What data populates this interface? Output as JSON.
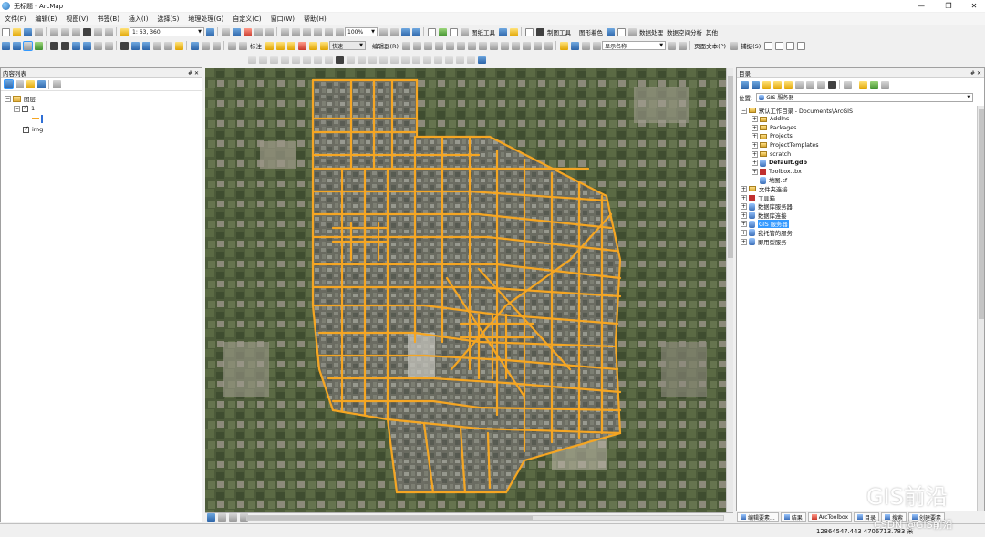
{
  "window": {
    "title": "无标题 - ArcMap",
    "controls": [
      "—",
      "❐",
      "✕"
    ]
  },
  "menu": [
    "文件(F)",
    "编辑(E)",
    "视图(V)",
    "书签(B)",
    "插入(I)",
    "选择(S)",
    "地理处理(G)",
    "自定义(C)",
    "窗口(W)",
    "帮助(H)"
  ],
  "toolbar1": {
    "scale": "1: 63, 360",
    "zoom": "100%",
    "georef_label": "图纸工具",
    "draw_label": "制图工具",
    "graphic_label": "图形着色",
    "data_proc_label": "数据处理",
    "spatial_label": "数据空间分析",
    "other_label": "其他"
  },
  "toolbar2": {
    "label_tool": "标注",
    "font_combo": "快速",
    "editor_label": "编辑器(R)",
    "display_combo": "显示名称",
    "layout_label": "页面文本(P)",
    "snapping_label": "捕捉(S)"
  },
  "toc": {
    "title": "内容列表",
    "header_controls": "# ✕",
    "layers_root": "图层",
    "layer1": "1",
    "layer2": "img"
  },
  "catalog": {
    "title": "目录",
    "header_controls": "# ✕",
    "location_label": "位置:",
    "location_value": "GIS 服务器",
    "tree": [
      {
        "label": "默认工作目录 - Documents\\ArcGIS",
        "level": 0,
        "expander": "−",
        "icon": "home"
      },
      {
        "label": "AddIns",
        "level": 1,
        "expander": "+",
        "icon": "folder"
      },
      {
        "label": "Packages",
        "level": 1,
        "expander": "+",
        "icon": "folder"
      },
      {
        "label": "Projects",
        "level": 1,
        "expander": "+",
        "icon": "folder"
      },
      {
        "label": "ProjectTemplates",
        "level": 1,
        "expander": "+",
        "icon": "folder"
      },
      {
        "label": "scratch",
        "level": 1,
        "expander": "+",
        "icon": "folder"
      },
      {
        "label": "Default.gdb",
        "level": 1,
        "expander": "+",
        "icon": "gdb",
        "bold": true
      },
      {
        "label": "Toolbox.tbx",
        "level": 1,
        "expander": "+",
        "icon": "box"
      },
      {
        "label": "地图.sf",
        "level": 1,
        "expander": "",
        "icon": "db"
      },
      {
        "label": "文件夹连接",
        "level": 0,
        "expander": "+",
        "icon": "folder"
      },
      {
        "label": "工具箱",
        "level": 0,
        "expander": "+",
        "icon": "box"
      },
      {
        "label": "数据库服务器",
        "level": 0,
        "expander": "+",
        "icon": "db"
      },
      {
        "label": "数据库连接",
        "level": 0,
        "expander": "+",
        "icon": "db"
      },
      {
        "label": "GIS 服务器",
        "level": 0,
        "expander": "+",
        "icon": "db",
        "selected": true
      },
      {
        "label": "我托管的服务",
        "level": 0,
        "expander": "+",
        "icon": "db"
      },
      {
        "label": "即用型服务",
        "level": 0,
        "expander": "+",
        "icon": "db"
      }
    ]
  },
  "bottom_tabs": [
    "编辑要素...",
    "结果",
    "ArcToolbox",
    "目录",
    "搜索",
    "创建要素"
  ],
  "status": {
    "coords": "12864547.443  4706713.783 米"
  },
  "watermark": {
    "name": "GIS前沿",
    "csdn": "CSDN @GIS前沿"
  },
  "colors": {
    "road": "#f5a623",
    "selection": "#3399ff"
  }
}
